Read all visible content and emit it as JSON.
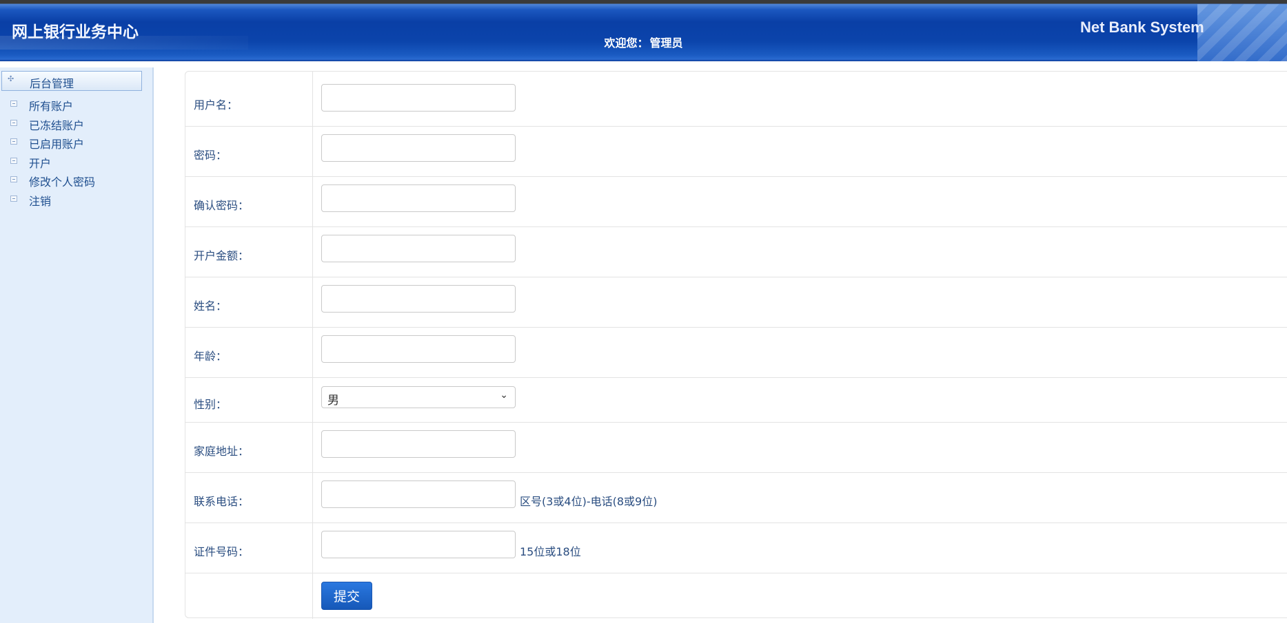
{
  "header": {
    "site_title": "网上银行业务中心",
    "welcome_prefix": "欢迎您：",
    "user_name": "管理员",
    "brand": "Net Bank System"
  },
  "sidebar": {
    "section_title": "后台管理",
    "items": [
      {
        "label": "所有账户"
      },
      {
        "label": "已冻结账户"
      },
      {
        "label": "已启用账户"
      },
      {
        "label": "开户"
      },
      {
        "label": "修改个人密码"
      },
      {
        "label": "注销"
      }
    ]
  },
  "form": {
    "username_label": "用户名：",
    "username_value": "",
    "password_label": "密码：",
    "password_value": "",
    "confirm_password_label": "确认密码：",
    "confirm_password_value": "",
    "opening_amount_label": "开户金额：",
    "opening_amount_value": "",
    "name_label": "姓名：",
    "name_value": "",
    "age_label": "年龄：",
    "age_value": "",
    "gender_label": "性别：",
    "gender_selected": "男",
    "address_label": "家庭地址：",
    "address_value": "",
    "phone_label": "联系电话：",
    "phone_value": "",
    "phone_hint": "区号(3或4位)-电话(8或9位)",
    "id_number_label": "证件号码：",
    "id_number_value": "",
    "id_number_hint": "15位或18位",
    "submit_label": "提交"
  },
  "colors": {
    "header_blue": "#0b44ab",
    "sidebar_bg": "#e3eefb",
    "submit_blue": "#1f68cc"
  }
}
